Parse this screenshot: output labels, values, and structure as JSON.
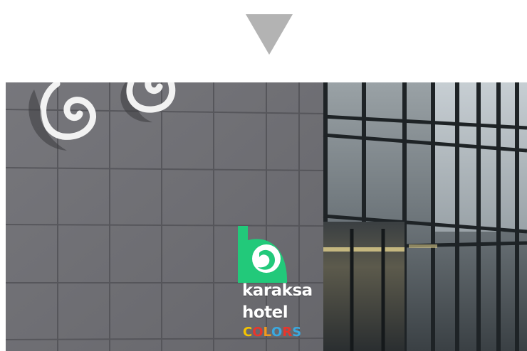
{
  "arrow": {
    "icon": "triangle-down-icon",
    "color": "#b3b3b3"
  },
  "photo": {
    "sign": {
      "line1": "karaksa",
      "line2": "hotel",
      "colors_letters": [
        "C",
        "O",
        "L",
        "O",
        "R",
        "S"
      ],
      "colors_palette": [
        "#f5c400",
        "#e8362c",
        "#f29a1e",
        "#3aa9e0",
        "#e8362c",
        "#3aa9e0"
      ],
      "logo_color": "#22c97a"
    },
    "wall_color": "#6f6f74",
    "glass_color": "#2b3136"
  }
}
